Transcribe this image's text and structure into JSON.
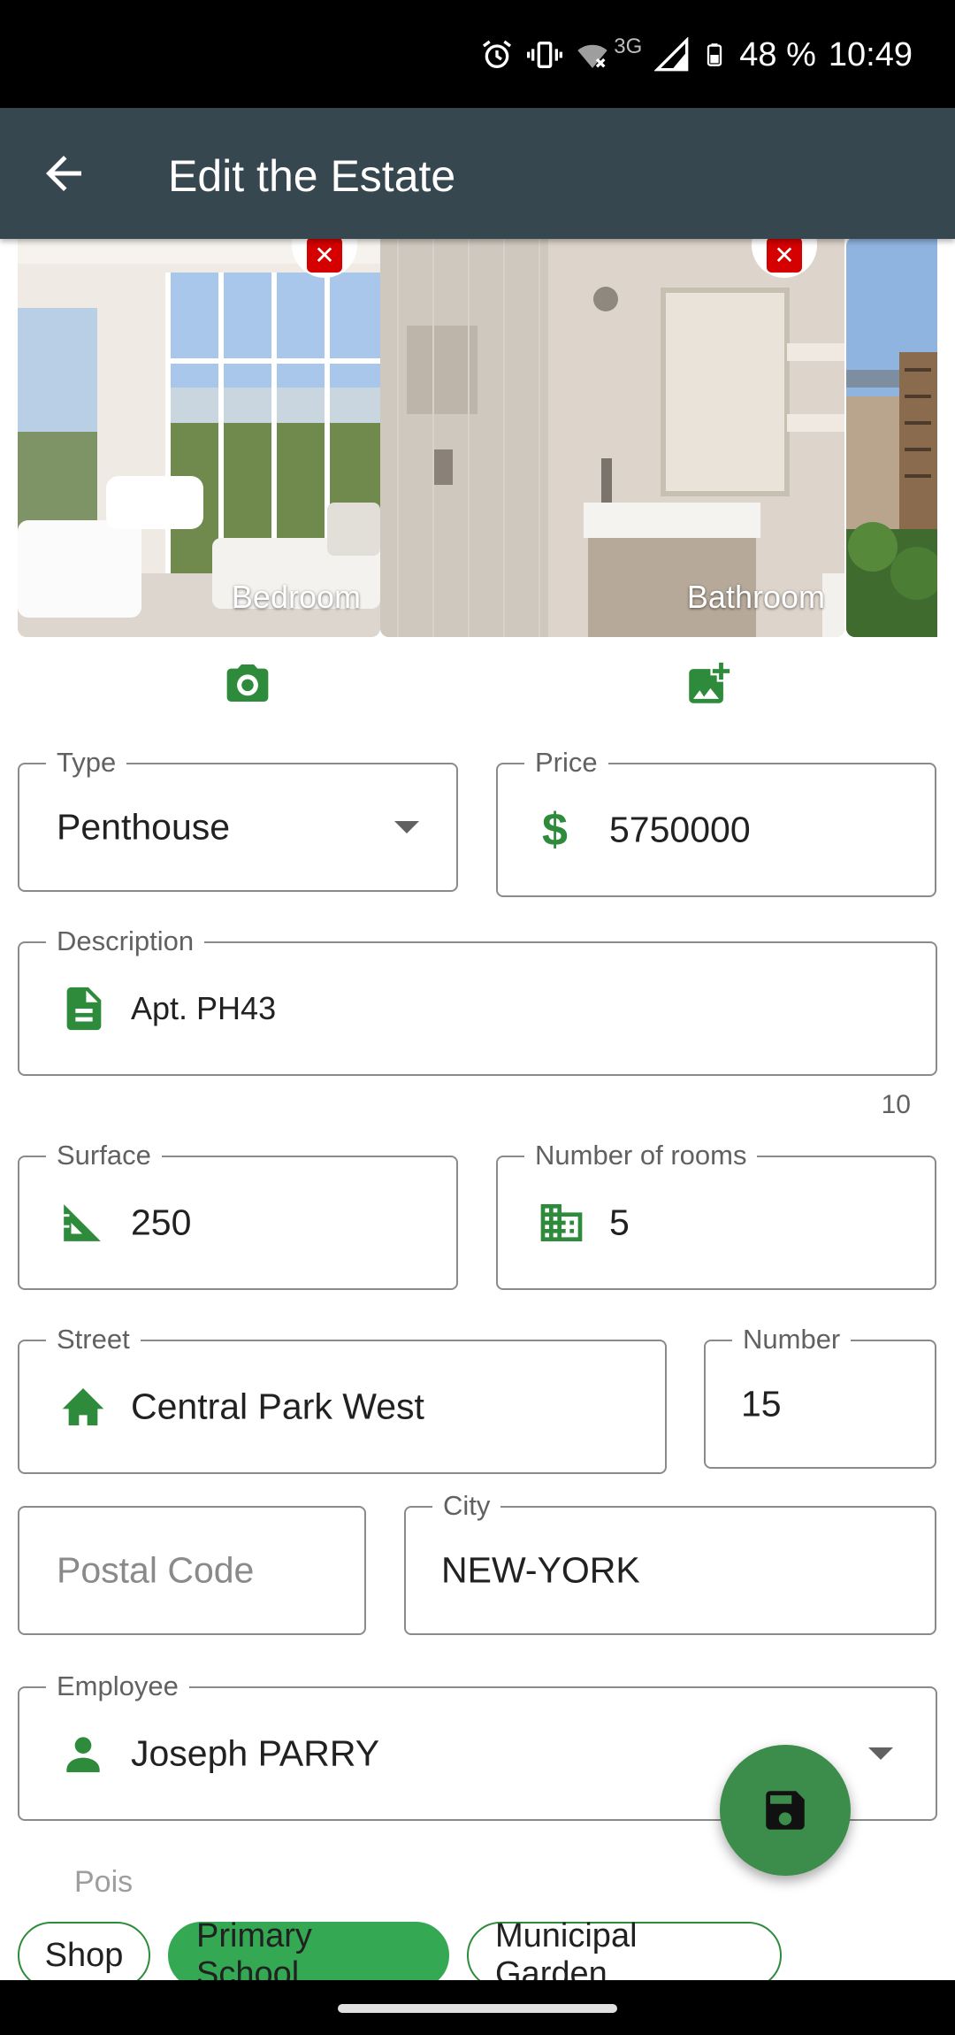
{
  "status_bar": {
    "network_type": "3G",
    "battery": "48 %",
    "time": "10:49"
  },
  "app_bar": {
    "title": "Edit the Estate"
  },
  "gallery": {
    "photos": [
      {
        "caption": "Bedroom"
      },
      {
        "caption": "Bathroom"
      },
      {
        "caption": ""
      }
    ]
  },
  "form": {
    "type": {
      "label": "Type",
      "value": "Penthouse"
    },
    "price": {
      "label": "Price",
      "value": "5750000"
    },
    "description": {
      "label": "Description",
      "value": "Apt. PH43",
      "counter": "10"
    },
    "surface": {
      "label": "Surface",
      "value": "250"
    },
    "rooms": {
      "label": "Number of rooms",
      "value": "5"
    },
    "street": {
      "label": "Street",
      "value": "Central Park West"
    },
    "number": {
      "label": "Number",
      "value": "15"
    },
    "postal_code": {
      "placeholder": "Postal Code"
    },
    "city": {
      "label": "City",
      "value": "NEW-YORK"
    },
    "employee": {
      "label": "Employee",
      "value": "Joseph PARRY"
    }
  },
  "pois": {
    "label": "Pois",
    "chips": [
      {
        "label": "Shop",
        "selected": false
      },
      {
        "label": "Primary School",
        "selected": true
      },
      {
        "label": "Municipal Garden",
        "selected": false
      }
    ]
  },
  "colors": {
    "app_bar": "#37474f",
    "accent_green": "#2e8b3b",
    "chip_selected": "#34a853",
    "fab": "#3c8c4c",
    "delete_red": "#d50000"
  },
  "icons": {
    "back": "arrow-left-icon",
    "camera": "camera-icon",
    "add_photo": "add-photo-icon",
    "price": "dollar-icon",
    "description": "document-icon",
    "surface": "set-square-icon",
    "rooms": "building-icon",
    "street": "house-icon",
    "employee": "person-icon",
    "save": "save-icon"
  }
}
